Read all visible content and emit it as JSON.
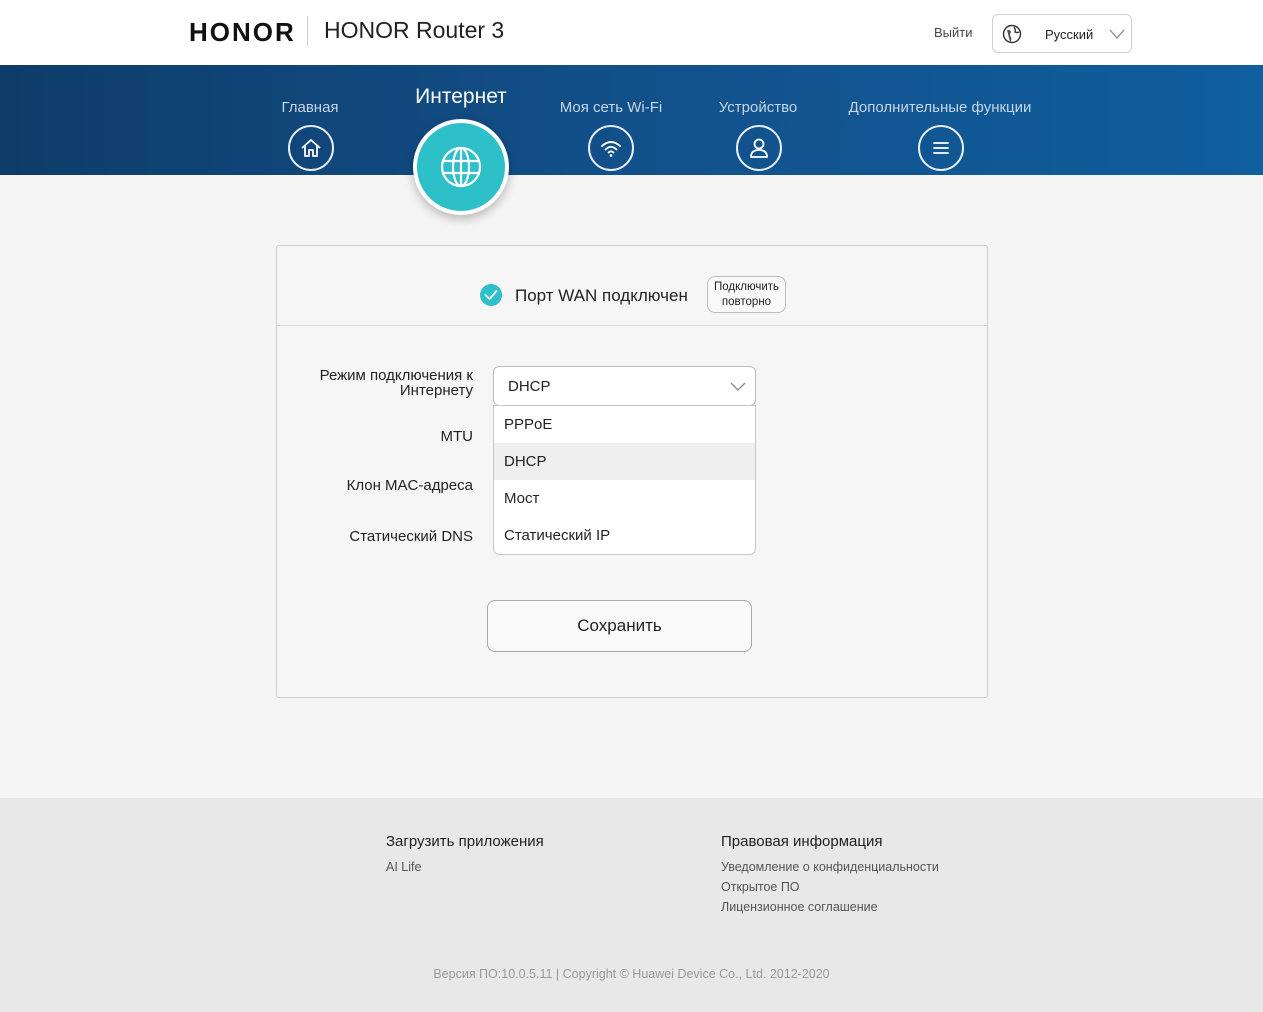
{
  "header": {
    "logo": "HONOR",
    "product": "HONOR Router 3",
    "logout": "Выйти",
    "language": "Русский"
  },
  "nav": {
    "items": [
      {
        "label": "Главная",
        "icon": "home-icon"
      },
      {
        "label": "Интернет",
        "icon": "globe-icon",
        "active": true
      },
      {
        "label": "Моя сеть Wi-Fi",
        "icon": "wifi-icon"
      },
      {
        "label": "Устройство",
        "icon": "user-icon"
      },
      {
        "label": "Дополнительные функции",
        "icon": "menu-icon"
      }
    ]
  },
  "status": {
    "text": "Порт WAN подключен",
    "reconnect_line1": "Подключить",
    "reconnect_line2": "повторно"
  },
  "form": {
    "mode_label": "Режим подключения к Интернету",
    "mtu_label": "MTU",
    "mac_label": "Клон MAC-адреса",
    "dns_label": "Статический DNS",
    "mode_value": "DHCP",
    "options": [
      "PPPoE",
      "DHCP",
      "Мост",
      "Статический IP"
    ],
    "selected_option": "DHCP",
    "save": "Сохранить"
  },
  "footer": {
    "apps_title": "Загрузить приложения",
    "apps_link": "AI Life",
    "legal_title": "Правовая информация",
    "legal_links": [
      "Уведомление о конфиденциальности",
      "Открытое ПО",
      "Лицензионное соглашение"
    ],
    "copyright": "Версия ПО:10.0.5.11 |  Copyright © Huawei Device Co., Ltd. 2012-2020"
  },
  "colors": {
    "accent": "#2ec0c8",
    "nav_dark": "#0e3c69",
    "nav_light": "#0f5e9e"
  }
}
